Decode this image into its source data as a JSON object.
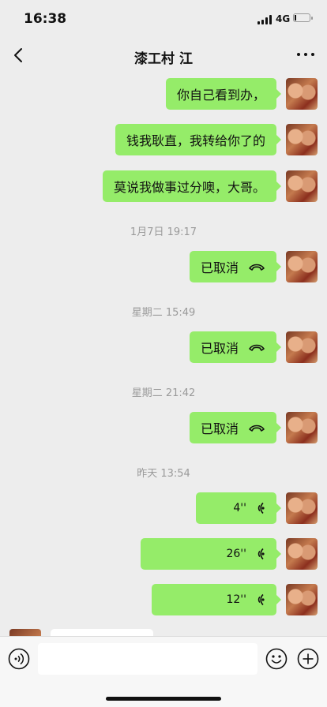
{
  "status": {
    "time": "16:38",
    "network": "4G"
  },
  "nav": {
    "title": "漆工村 江"
  },
  "messages": [
    {
      "text": "你自己看到办，"
    },
    {
      "text": "钱我耿直，我转给你了的"
    },
    {
      "text": "莫说我做事过分噢，大哥。"
    }
  ],
  "timestamps": [
    "1月7日 19:17",
    "星期二 15:49",
    "星期二 21:42",
    "昨天 13:54"
  ],
  "calls": [
    {
      "text": "已取消",
      "icon": "phone-hangup-icon"
    },
    {
      "text": "已取消",
      "icon": "phone-hangup-icon"
    },
    {
      "text": "已取消",
      "icon": "phone-hangup-icon"
    }
  ],
  "voices": [
    {
      "duration": "4''"
    },
    {
      "duration": "26''"
    },
    {
      "duration": "12''"
    }
  ],
  "input": {
    "value": "",
    "voice_icon": "voice-input-icon",
    "emoji_icon": "emoji-icon",
    "plus_icon": "plus-icon"
  },
  "colors": {
    "bubble": "#95ec69",
    "background": "#ededed"
  }
}
